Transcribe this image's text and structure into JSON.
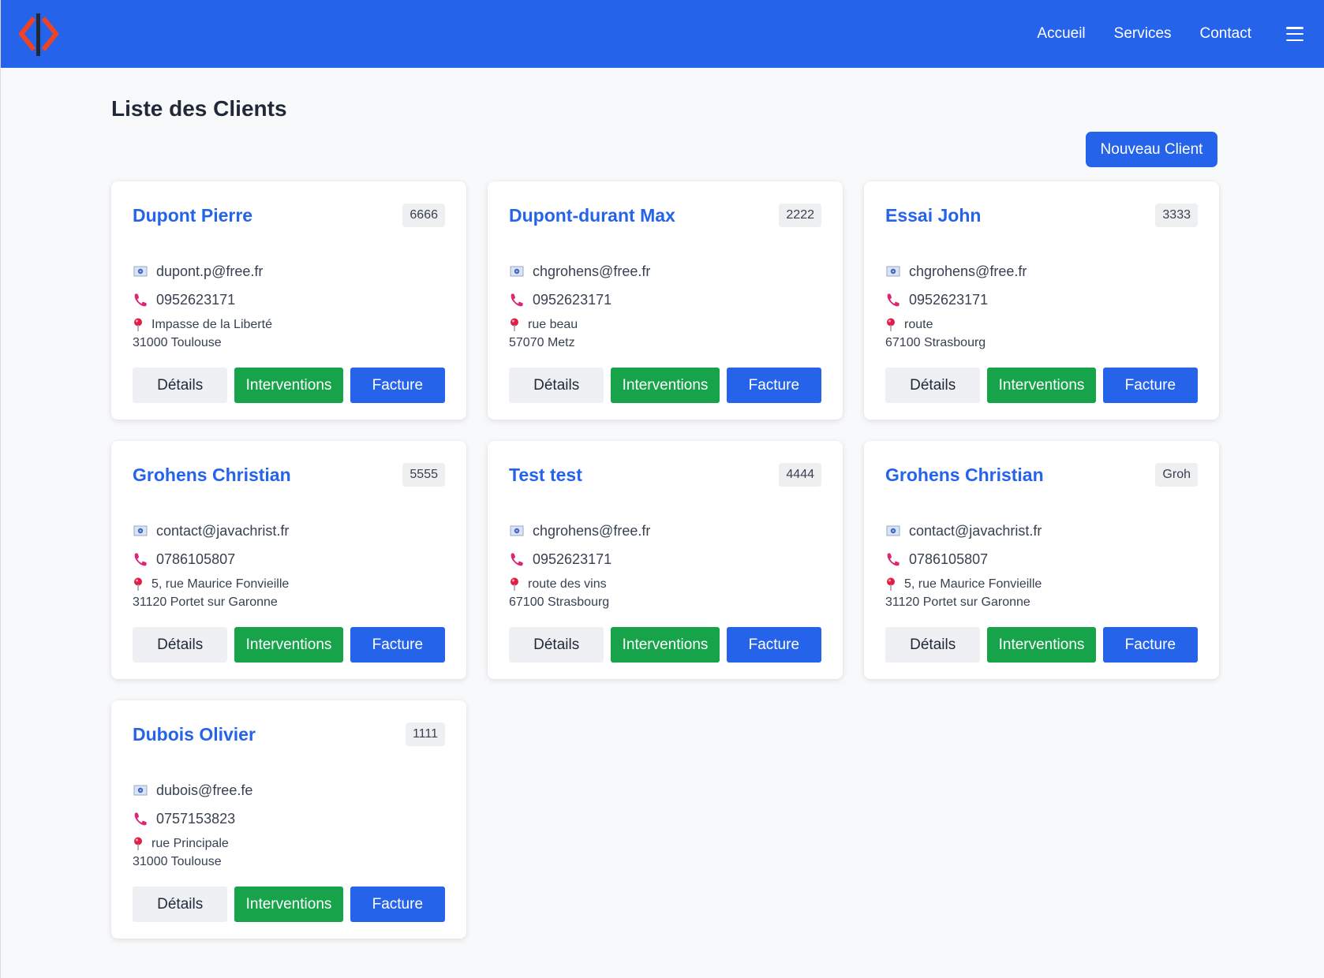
{
  "nav": {
    "links": [
      "Accueil",
      "Services",
      "Contact"
    ]
  },
  "page": {
    "title": "Liste des Clients",
    "new_client_label": "Nouveau Client"
  },
  "buttons": {
    "details": "Détails",
    "interventions": "Interventions",
    "facture": "Facture"
  },
  "colors": {
    "primary": "#2563eb",
    "success": "#16a34a",
    "icon_accent": "#db2777"
  },
  "icons": {
    "email": "email-envelope-icon",
    "phone": "phone-icon",
    "address": "map-pin-icon",
    "menu": "hamburger-menu-icon",
    "logo": "code-brackets-logo"
  },
  "clients": [
    {
      "name": "Dupont Pierre",
      "code": "6666",
      "email": "dupont.p@free.fr",
      "phone": "0952623171",
      "street": "Impasse de la Liberté",
      "city": "31000 Toulouse"
    },
    {
      "name": "Dupont-durant Max",
      "code": "2222",
      "email": "chgrohens@free.fr",
      "phone": "0952623171",
      "street": "rue beau",
      "city": "57070 Metz"
    },
    {
      "name": "Essai John",
      "code": "3333",
      "email": "chgrohens@free.fr",
      "phone": "0952623171",
      "street": "route",
      "city": "67100 Strasbourg"
    },
    {
      "name": "Grohens Christian",
      "code": "5555",
      "email": "contact@javachrist.fr",
      "phone": "0786105807",
      "street": "5, rue Maurice Fonvieille",
      "city": "31120 Portet sur Garonne"
    },
    {
      "name": "Test test",
      "code": "4444",
      "email": "chgrohens@free.fr",
      "phone": "0952623171",
      "street": "route des vins",
      "city": "67100 Strasbourg"
    },
    {
      "name": "Grohens Christian",
      "code": "Groh",
      "email": "contact@javachrist.fr",
      "phone": "0786105807",
      "street": "5, rue Maurice Fonvieille",
      "city": "31120 Portet sur Garonne"
    },
    {
      "name": "Dubois Olivier",
      "code": "1111",
      "email": "dubois@free.fe",
      "phone": "0757153823",
      "street": "rue Principale",
      "city": "31000 Toulouse"
    }
  ]
}
